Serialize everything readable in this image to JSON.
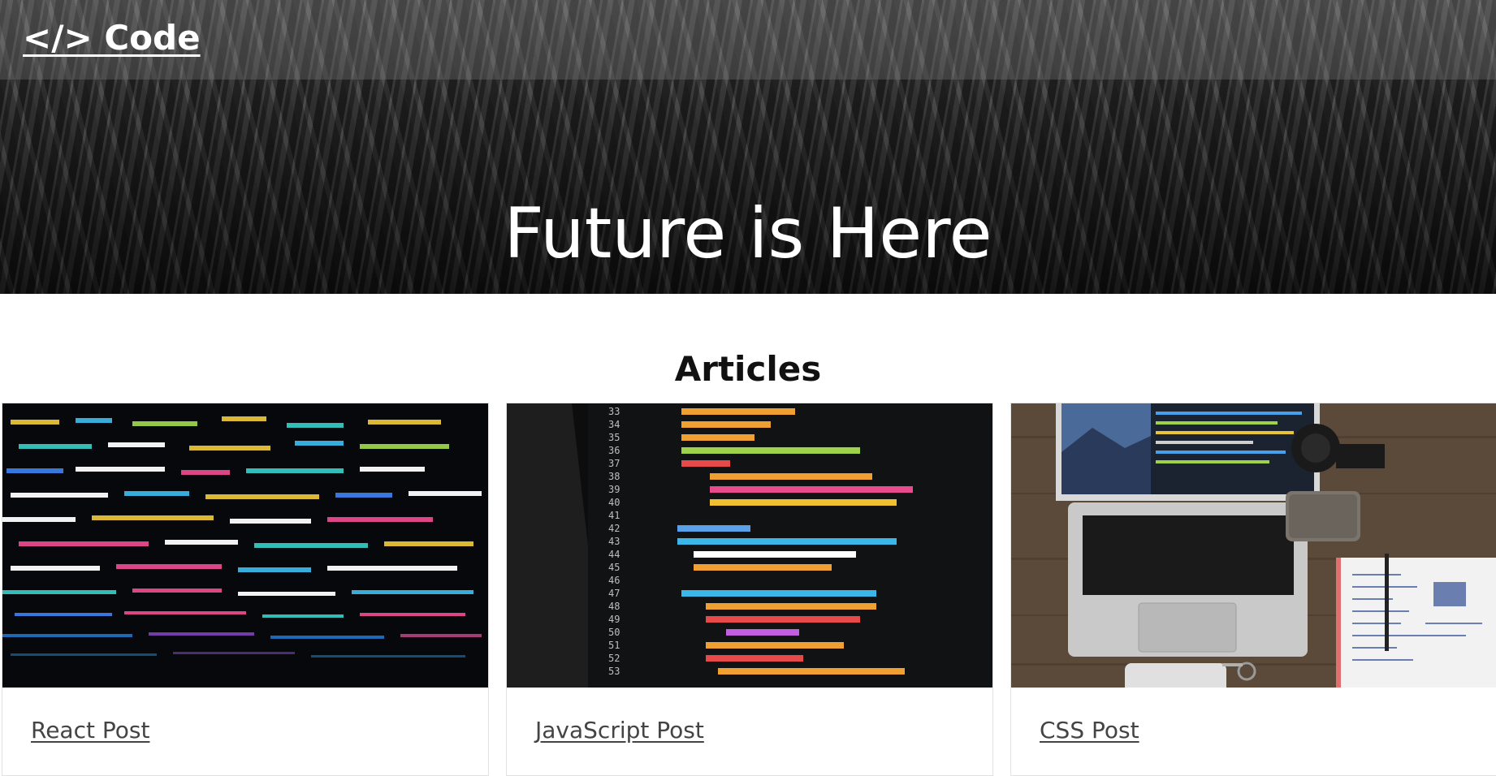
{
  "header": {
    "brand": "</> Code",
    "hero_title": "Future is Here"
  },
  "articles": {
    "title": "Articles",
    "items": [
      {
        "label": "React Post",
        "image": "code-screen-colorful"
      },
      {
        "label": "JavaScript Post",
        "image": "python-code-monitor"
      },
      {
        "label": "CSS Post",
        "image": "laptop-desk-notebook"
      }
    ]
  }
}
